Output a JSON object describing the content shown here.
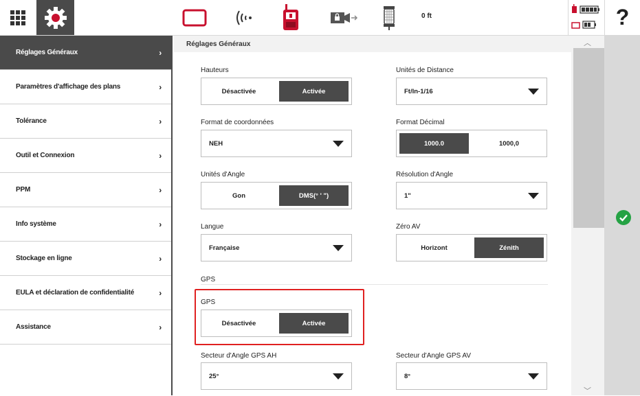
{
  "topbar": {
    "distance": "0 ft",
    "help": "?",
    "icons": [
      "grid-menu-icon",
      "gear-icon",
      "screen-icon",
      "signal-icon",
      "controller-icon",
      "camera-lock-icon",
      "prism-icon"
    ],
    "accent": "#c8102e"
  },
  "sidebar": {
    "items": [
      {
        "label": "Réglages Généraux",
        "active": true
      },
      {
        "label": "Paramètres d'affichage des plans"
      },
      {
        "label": "Tolérance"
      },
      {
        "label": "Outil et Connexion"
      },
      {
        "label": "PPM"
      },
      {
        "label": "Info système"
      },
      {
        "label": "Stockage en ligne"
      },
      {
        "label": "EULA et déclaration de confidentialité"
      },
      {
        "label": "Assistance"
      }
    ]
  },
  "main": {
    "title": "Réglages Généraux",
    "heights": {
      "label": "Hauteurs",
      "off": "Désactivée",
      "on": "Activée",
      "selected": "Activée"
    },
    "distance_unit": {
      "label": "Unités de Distance",
      "value": "Ft/In-1/16"
    },
    "coord_format": {
      "label": "Format de coordonnées",
      "value": "NEH"
    },
    "decimal_format": {
      "label": "Format Décimal",
      "opt1": "1000.0",
      "opt2": "1000,0",
      "selected": "1000.0"
    },
    "angle_unit": {
      "label": "Unités d'Angle",
      "opt1": "Gon",
      "opt2": "DMS(° ' \")",
      "selected": "DMS(° ' \")"
    },
    "angle_res": {
      "label": "Résolution d'Angle",
      "value": "1\""
    },
    "language": {
      "label": "Langue",
      "value": "Française"
    },
    "zero_av": {
      "label": "Zéro AV",
      "opt1": "Horizont",
      "opt2": "Zénith",
      "selected": "Zénith"
    },
    "gps_section": "GPS",
    "gps": {
      "label": "GPS",
      "off": "Désactivée",
      "on": "Activée",
      "selected": "Activée"
    },
    "gps_ah": {
      "label": "Secteur d'Angle GPS AH",
      "value": "25°"
    },
    "gps_av": {
      "label": "Secteur d'Angle GPS AV",
      "value": "8°"
    }
  }
}
